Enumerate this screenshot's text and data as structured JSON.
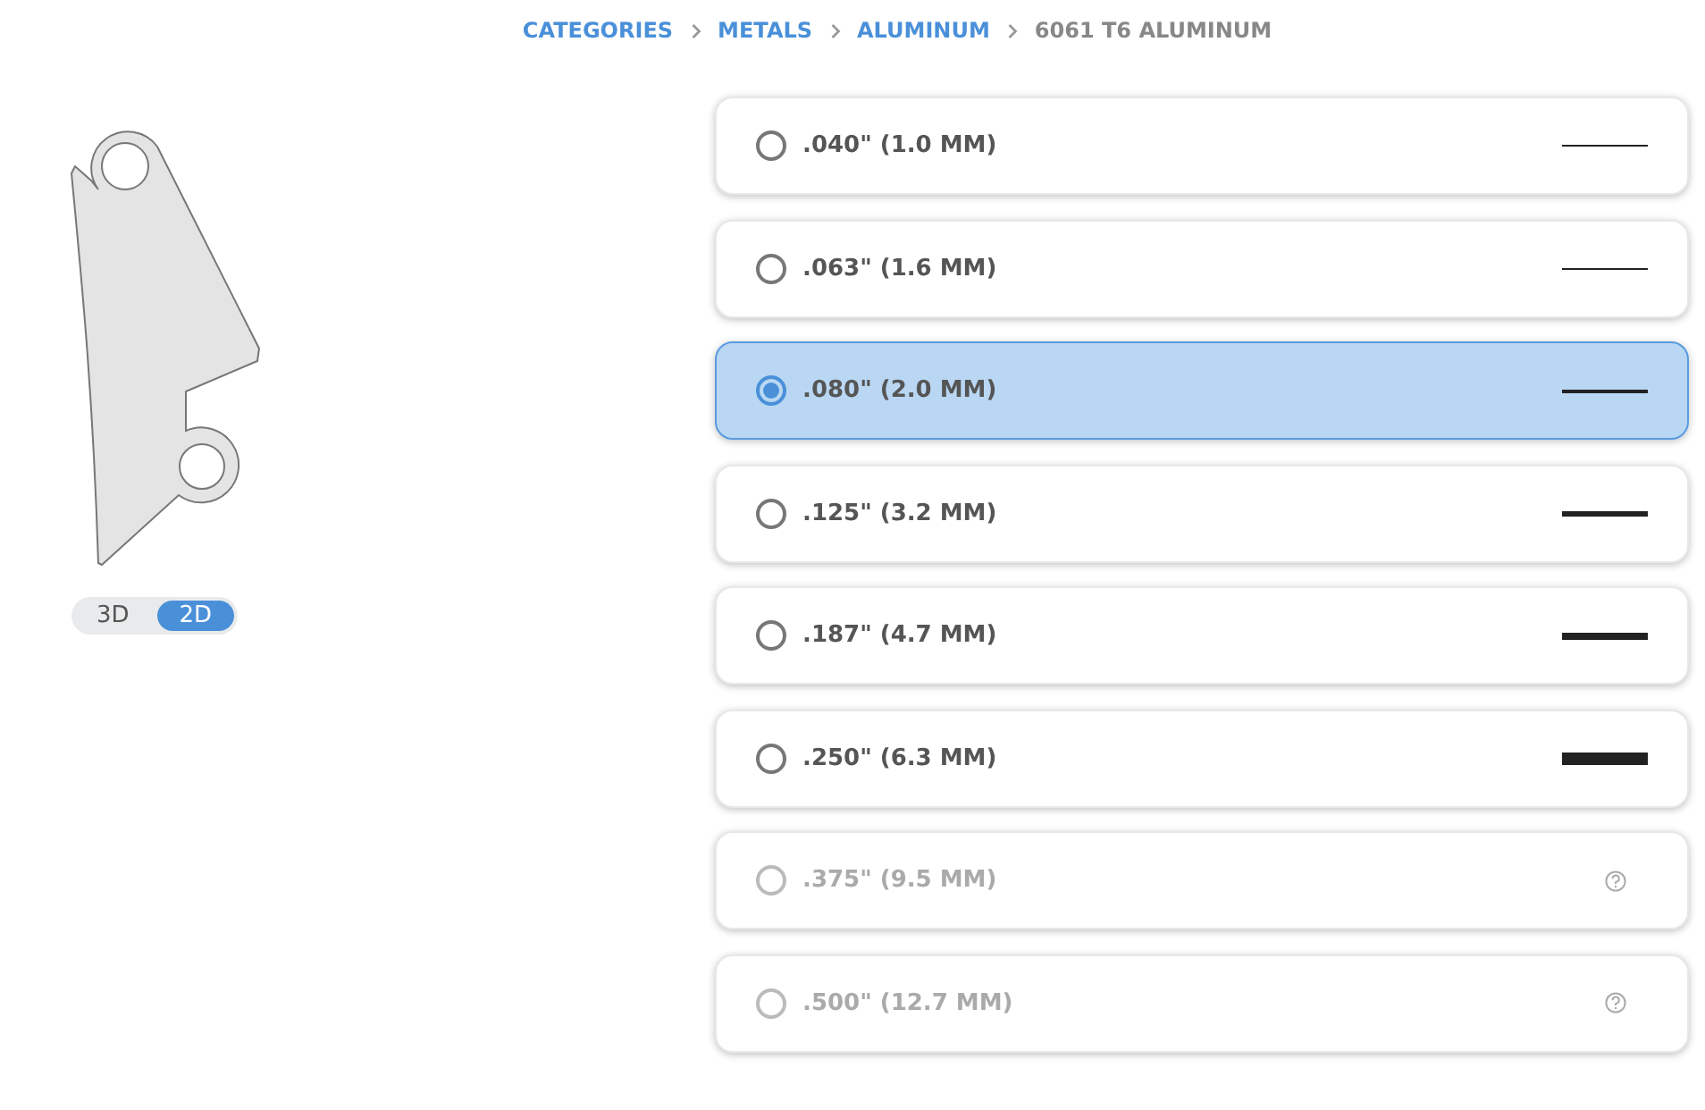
{
  "breadcrumb": [
    {
      "label": "CATEGORIES",
      "link": true
    },
    {
      "label": "METALS",
      "link": true
    },
    {
      "label": "ALUMINUM",
      "link": true
    },
    {
      "label": "6061 T6 ALUMINUM",
      "link": false
    }
  ],
  "view_toggle": [
    {
      "label": "3D",
      "selected": false
    },
    {
      "label": "2D",
      "selected": true
    }
  ],
  "options": [
    {
      "label": ".040\" (1.0 MM)",
      "selected": false,
      "disabled": false
    },
    {
      "label": ".063\" (1.6 MM)",
      "selected": false,
      "disabled": false
    },
    {
      "label": ".080\" (2.0 MM)",
      "selected": true,
      "disabled": false
    },
    {
      "label": ".125\" (3.2 MM)",
      "selected": false,
      "disabled": false
    },
    {
      "label": ".187\" (4.7 MM)",
      "selected": false,
      "disabled": false
    },
    {
      "label": ".250\" (6.3 MM)",
      "selected": false,
      "disabled": false
    },
    {
      "label": ".375\" (9.5 MM)",
      "selected": false,
      "disabled": true
    },
    {
      "label": ".500\" (12.7 MM)",
      "selected": false,
      "disabled": true
    }
  ]
}
